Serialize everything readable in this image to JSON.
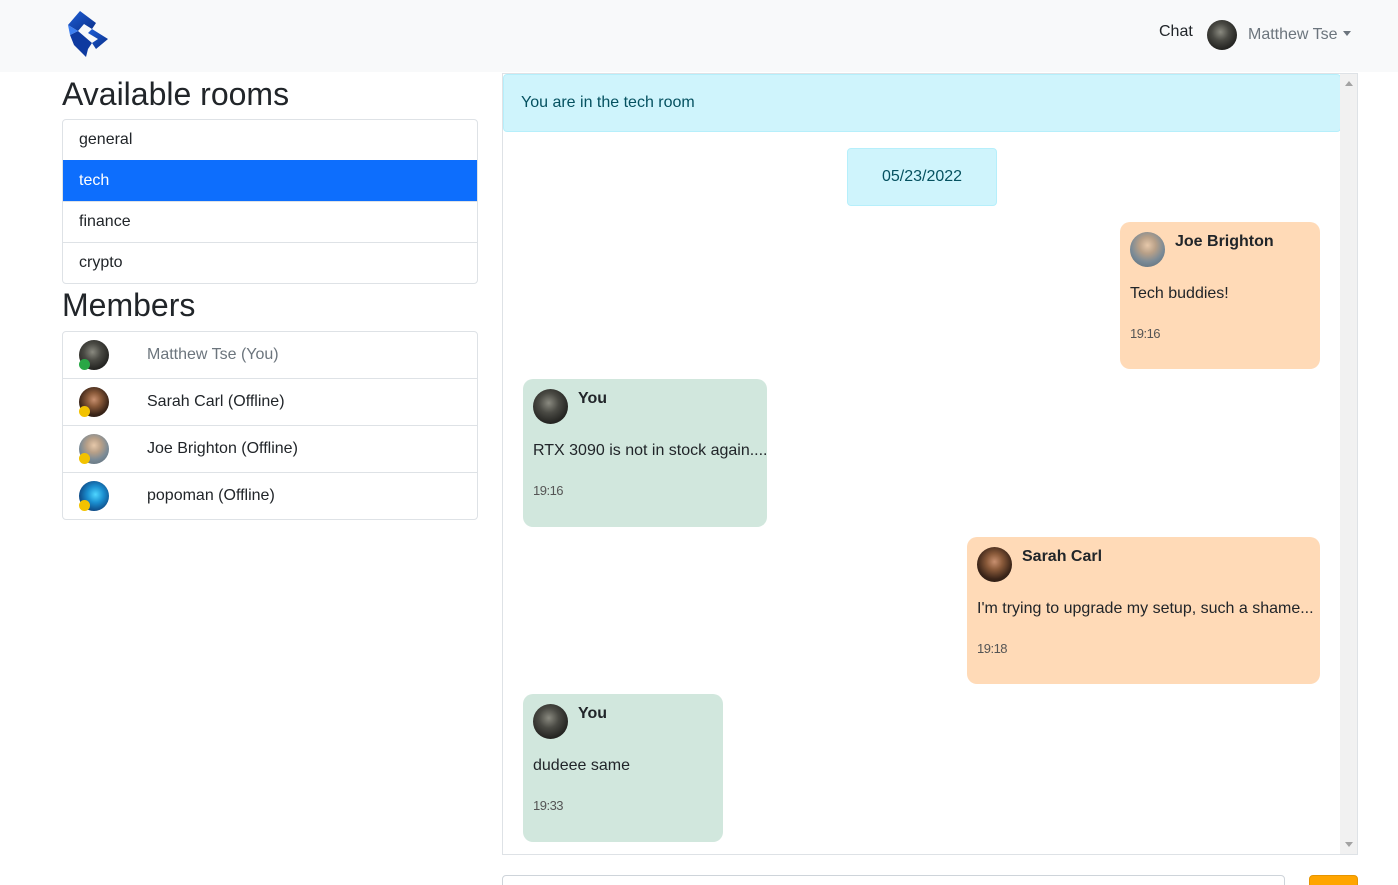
{
  "navbar": {
    "chat_link": "Chat",
    "user_name": "Matthew Tse"
  },
  "sidebar": {
    "rooms_title": "Available rooms",
    "rooms": [
      {
        "label": "general",
        "active": false
      },
      {
        "label": "tech",
        "active": true
      },
      {
        "label": "finance",
        "active": false
      },
      {
        "label": "crypto",
        "active": false
      }
    ],
    "members_title": "Members",
    "members": [
      {
        "label": "Matthew Tse (You)",
        "status": "online"
      },
      {
        "label": "Sarah Carl (Offline)",
        "status": "offline"
      },
      {
        "label": "Joe Brighton (Offline)",
        "status": "offline"
      },
      {
        "label": "popoman (Offline)",
        "status": "offline"
      }
    ]
  },
  "chat": {
    "room_notice": "You are in the tech room",
    "date": "05/23/2022",
    "messages": [
      {
        "sender": "Joe Brighton",
        "text": "Tech buddies!",
        "time": "19:16",
        "direction": "incoming"
      },
      {
        "sender": "You",
        "text": "RTX 3090 is not in stock again....",
        "time": "19:16",
        "direction": "outgoing"
      },
      {
        "sender": "Sarah Carl",
        "text": "I'm trying to upgrade my setup, such a shame...",
        "time": "19:18",
        "direction": "incoming"
      },
      {
        "sender": "You",
        "text": "dudeee same",
        "time": "19:33",
        "direction": "outgoing"
      }
    ]
  },
  "colors": {
    "active_room": "#0d6efd",
    "incoming_bubble": "#ffdab7",
    "outgoing_bubble": "#d1e7dd",
    "info_alert": "#cff4fc",
    "online_status": "#28a745",
    "offline_status": "#f2c200",
    "send_button": "#ffa500"
  }
}
